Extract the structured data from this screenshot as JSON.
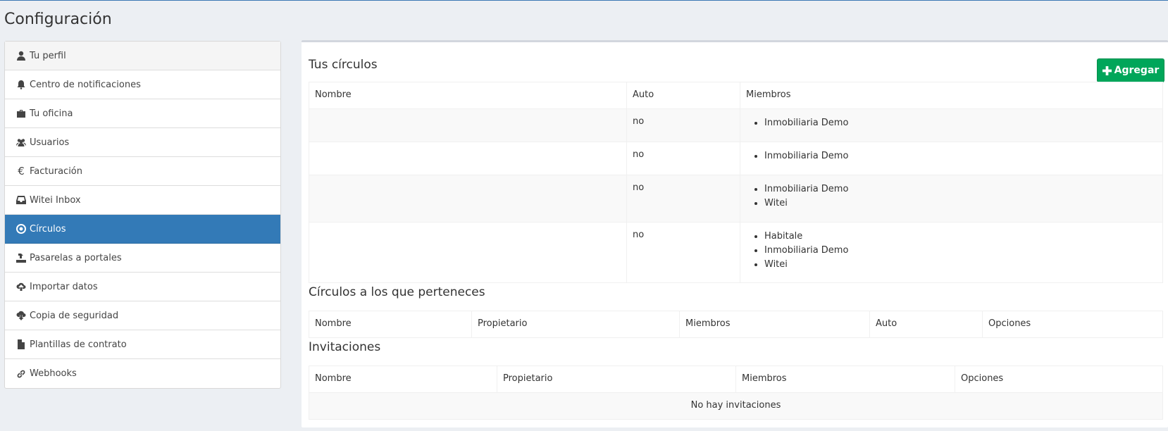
{
  "page": {
    "title": "Configuración"
  },
  "sidebar": {
    "items": [
      {
        "label": "Tu perfil",
        "icon": "user-icon"
      },
      {
        "label": "Centro de notificaciones",
        "icon": "bell-icon"
      },
      {
        "label": "Tu oficina",
        "icon": "briefcase-icon"
      },
      {
        "label": "Usuarios",
        "icon": "users-icon"
      },
      {
        "label": "Facturación",
        "icon": "euro-icon"
      },
      {
        "label": "Witei Inbox",
        "icon": "inbox-icon"
      },
      {
        "label": "Círculos",
        "icon": "circle-dot-icon"
      },
      {
        "label": "Pasarelas a portales",
        "icon": "upload-tray-icon"
      },
      {
        "label": "Importar datos",
        "icon": "cloud-upload-icon"
      },
      {
        "label": "Copia de seguridad",
        "icon": "cloud-download-icon"
      },
      {
        "label": "Plantillas de contrato",
        "icon": "file-icon"
      },
      {
        "label": "Webhooks",
        "icon": "link-icon"
      }
    ],
    "active_index": 6
  },
  "circles": {
    "title": "Tus círculos",
    "add_label": "Agregar",
    "columns": [
      "Nombre",
      "Auto",
      "Miembros"
    ],
    "rows": [
      {
        "name": "",
        "auto": "no",
        "members": [
          "Inmobiliaria Demo"
        ]
      },
      {
        "name": "",
        "auto": "no",
        "members": [
          "Inmobiliaria Demo"
        ]
      },
      {
        "name": "",
        "auto": "no",
        "members": [
          "Inmobiliaria Demo",
          "Witei"
        ]
      },
      {
        "name": "",
        "auto": "no",
        "members": [
          "Habitale",
          "Inmobiliaria Demo",
          "Witei"
        ]
      }
    ]
  },
  "belongs": {
    "title": "Círculos a los que perteneces",
    "columns": [
      "Nombre",
      "Propietario",
      "Miembros",
      "Auto",
      "Opciones"
    ]
  },
  "invitations": {
    "title": "Invitaciones",
    "columns": [
      "Nombre",
      "Propietario",
      "Miembros",
      "Opciones"
    ],
    "empty": "No hay invitaciones"
  }
}
